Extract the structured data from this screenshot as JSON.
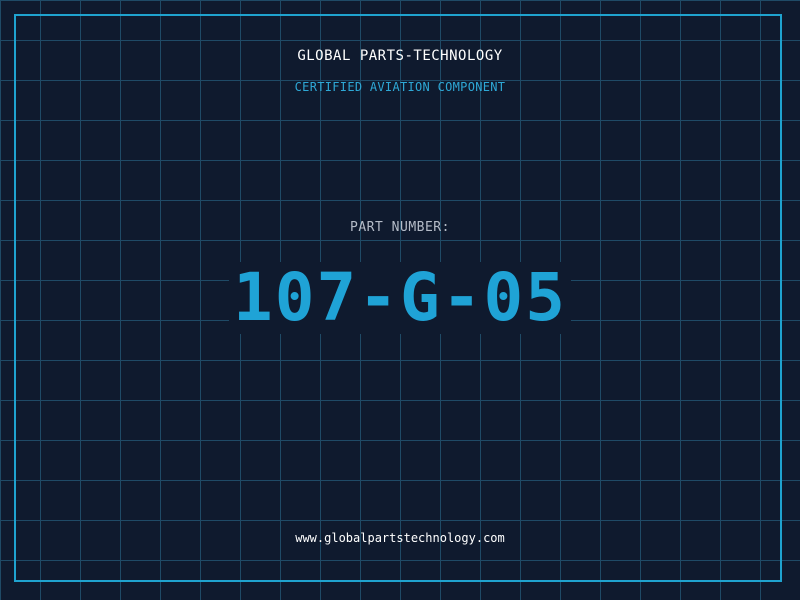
{
  "brand": {
    "name": "GLOBAL PARTS-TECHNOLOGY",
    "tagline": "CERTIFIED AVIATION COMPONENT"
  },
  "part": {
    "label": "PART NUMBER:",
    "number": "107-G-05"
  },
  "footer": {
    "url": "www.globalpartstechnology.com"
  },
  "colors": {
    "background": "#0f1a2e",
    "grid": "#1f4a66",
    "accent": "#1fa3d6",
    "text": "#ffffff"
  }
}
